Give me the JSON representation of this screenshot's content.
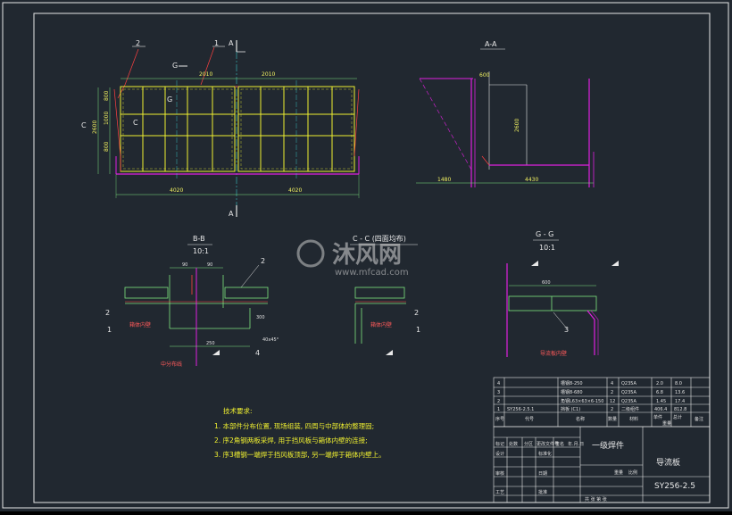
{
  "views": {
    "section_aa": "A-A",
    "section_bb": "B-B",
    "section_bb_scale": "10:1",
    "section_cc": "C - C (四面均布)",
    "section_gg": "G - G",
    "section_gg_scale": "10:1"
  },
  "callouts": {
    "part1": "1",
    "part2": "2",
    "part3": "3",
    "part4": "4",
    "sec_a": "A",
    "sec_c": "C",
    "sec_g": "G"
  },
  "dimensions": {
    "span_top_left": "2010",
    "span_top_right": "2010",
    "span_bottom_left": "4020",
    "span_bottom_right": "4020",
    "height_total": "2600",
    "h_seg1": "800",
    "h_seg2": "1000",
    "h_seg3": "800",
    "aa_top": "600",
    "aa_height": "2600",
    "aa_left": "1480",
    "aa_right": "4430",
    "bb_90a": "90",
    "bb_90b": "90",
    "bb_250": "250",
    "bb_300": "300",
    "bb_chamfer": "40x45°",
    "gg_600": "600"
  },
  "annotations": {
    "weld_box": "箱体内壁",
    "center_pos": "中分布线",
    "weld_box2": "箱体内壁",
    "gg_weld": "导流板内壁"
  },
  "tech_req": {
    "title": "技术要求:",
    "items": [
      "1. 本部件分布位置, 现场组装, 四周与中部体的整理固;",
      "2. 序2角钢两板采焊, 用于挡风板与箱体内壁的连接;",
      "3. 序3槽钢一端焊于挡风板顶部, 另一端焊于箱体内壁上。"
    ]
  },
  "bom": {
    "rows": [
      {
        "no": "4",
        "code": "",
        "name": "槽钢8-250",
        "qty": "4",
        "mat": "Q235A",
        "w1": "2.0",
        "w2": "8.0"
      },
      {
        "no": "3",
        "code": "",
        "name": "槽钢8-680",
        "qty": "2",
        "mat": "Q235A",
        "w1": "6.8",
        "w2": "13.6"
      },
      {
        "no": "2",
        "code": "",
        "name": "角钢L63×63×6-150",
        "qty": "12",
        "mat": "Q235A",
        "w1": "1.45",
        "w2": "17.4"
      },
      {
        "no": "1",
        "code": "SY256-2.5.1",
        "name": "挡板 (C1)",
        "qty": "2",
        "mat": "二级组件",
        "w1": "406.4",
        "w2": "812.8"
      }
    ],
    "header": {
      "no": "序号",
      "code": "代号",
      "name": "名称",
      "qty": "数量",
      "mat": "材料",
      "single": "单件",
      "total": "总计",
      "weight": "重量",
      "note": "备注"
    }
  },
  "title_block": {
    "assembly_type": "一级焊件",
    "part_name": "导流板",
    "drawing_no": "SY256-2.5",
    "scale_label": "比例",
    "weight_label": "重量",
    "design": "设计",
    "check": "审核",
    "std": "标准化",
    "process": "工艺",
    "approve": "批准",
    "date": "日期",
    "sheet": "共 张 第 张",
    "marking": "标记",
    "count": "处数",
    "zone": "分区",
    "change_doc": "更改文件号",
    "sign": "签名",
    "ymd": "年.月.日"
  },
  "watermark": {
    "brand": "沐风网",
    "url": "www.mfcad.com"
  },
  "colors": {
    "background": "#212830",
    "frame": "#e8e8e8",
    "dim_green": "#7fe57f",
    "yellow": "#f0f030",
    "magenta": "#e020e0",
    "red": "#ff4040",
    "cyan": "#40e0e0"
  }
}
